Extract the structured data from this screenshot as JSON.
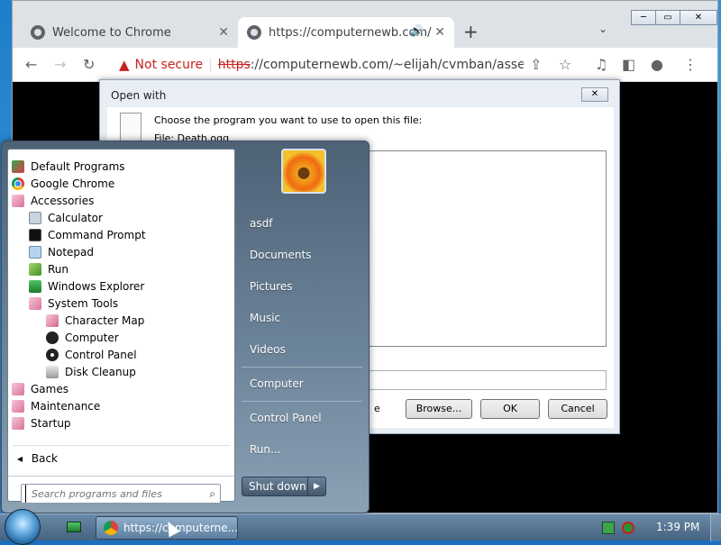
{
  "browser": {
    "tabs": [
      {
        "title": "Welcome to Chrome",
        "active": false
      },
      {
        "title": "https://computernewb.com/",
        "active": true
      }
    ],
    "address": {
      "warning_label": "Not secure",
      "scheme": "https",
      "url_rest": "://computernewb.com/~elijah/cvmban/assets/..."
    }
  },
  "dialog": {
    "title": "Open with",
    "prompt": "Choose the program you want to use to open this file:",
    "file_line": "File:   Death.ogg",
    "trailing_text": "e",
    "buttons": {
      "browse": "Browse...",
      "ok": "OK",
      "cancel": "Cancel"
    }
  },
  "start_menu": {
    "programs": [
      {
        "label": "Default Programs",
        "indent": 0,
        "icon": "default-programs-icon"
      },
      {
        "label": "Google Chrome",
        "indent": 0,
        "icon": "chrome-icon"
      },
      {
        "label": "Accessories",
        "indent": 0,
        "icon": "folder-icon"
      },
      {
        "label": "Calculator",
        "indent": 1,
        "icon": "calculator-icon"
      },
      {
        "label": "Command Prompt",
        "indent": 1,
        "icon": "command-prompt-icon"
      },
      {
        "label": "Notepad",
        "indent": 1,
        "icon": "notepad-icon"
      },
      {
        "label": "Run",
        "indent": 1,
        "icon": "run-icon"
      },
      {
        "label": "Windows Explorer",
        "indent": 1,
        "icon": "explorer-icon"
      },
      {
        "label": "System Tools",
        "indent": 1,
        "icon": "folder-icon"
      },
      {
        "label": "Character Map",
        "indent": 2,
        "icon": "character-map-icon"
      },
      {
        "label": "Computer",
        "indent": 2,
        "icon": "computer-icon"
      },
      {
        "label": "Control Panel",
        "indent": 2,
        "icon": "control-panel-icon"
      },
      {
        "label": "Disk Cleanup",
        "indent": 2,
        "icon": "disk-cleanup-icon"
      },
      {
        "label": "Games",
        "indent": 0,
        "icon": "folder-icon"
      },
      {
        "label": "Maintenance",
        "indent": 0,
        "icon": "folder-icon"
      },
      {
        "label": "Startup",
        "indent": 0,
        "icon": "folder-icon"
      }
    ],
    "back_label": "Back",
    "search_placeholder": "Search programs and files",
    "right": {
      "user": "asdf",
      "documents": "Documents",
      "pictures": "Pictures",
      "music": "Music",
      "videos": "Videos",
      "computer": "Computer",
      "control_panel": "Control Panel",
      "run": "Run..."
    },
    "shutdown_label": "Shut down"
  },
  "taskbar": {
    "task_label": "https://computerne...",
    "clock": "1:39 PM"
  }
}
